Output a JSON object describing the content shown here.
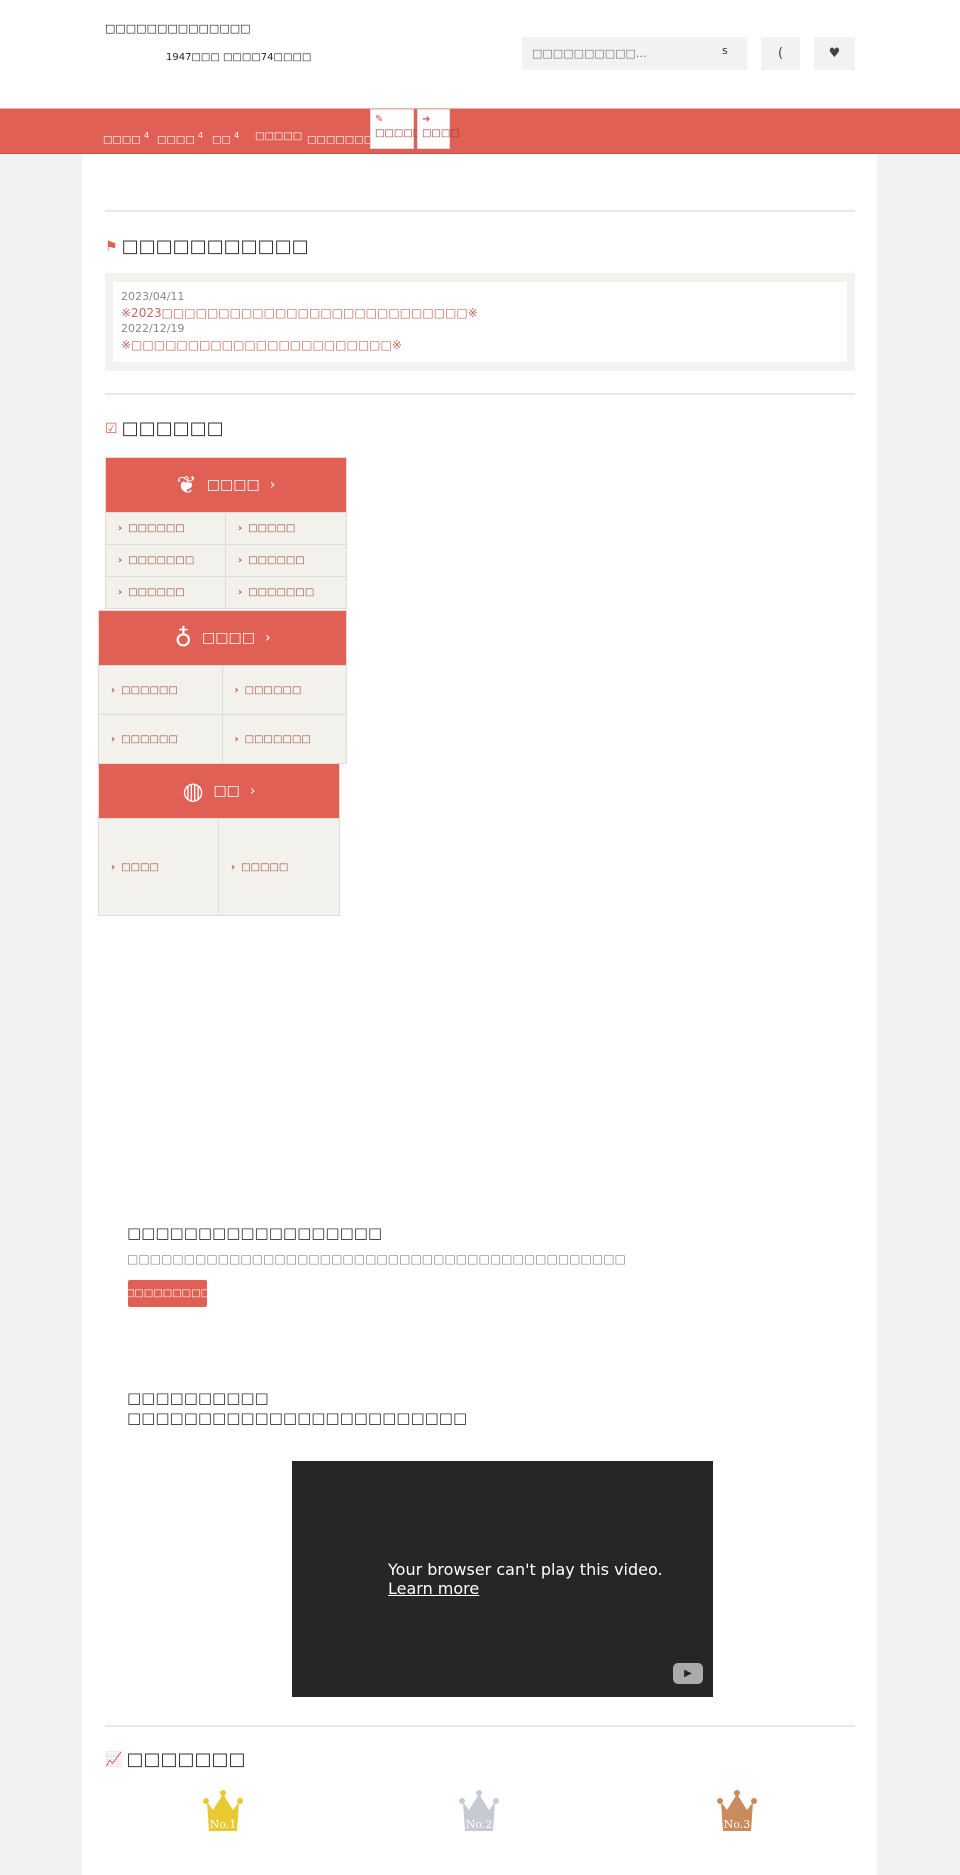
{
  "header": {
    "site_title": "□□□□□□□□□□□□□□",
    "site_subtitle": "1947□□□ □□□□74□□□□",
    "search_placeholder": "□□□□□□□□□□...",
    "search_button": "s",
    "button_1": "(",
    "favorite_icon": "heart-icon"
  },
  "nav": {
    "items": [
      {
        "label": "□□□□",
        "badge": "4"
      },
      {
        "label": "□□□□",
        "badge": "4"
      },
      {
        "label": "□□",
        "badge": "4"
      },
      {
        "label": "□□□□□",
        "badge": ""
      },
      {
        "label": "□□□□□□□",
        "badge": "4"
      }
    ],
    "register": "□□□□□□",
    "login": "□□□□"
  },
  "news": {
    "heading": "□□□□□□□□□□□",
    "items": [
      {
        "date": "2023/04/11",
        "title": "※2023□□□□□□□□□□□□□□□□□□□□□□□□□□□※"
      },
      {
        "date": "2022/12/19",
        "title": "※□□□□□□□□□□□□□□□□□□□□□□□※"
      }
    ]
  },
  "categories": {
    "heading": "□□□□□□",
    "groups": [
      {
        "title": "□□□□",
        "icon": "ginger-icon",
        "items": [
          "□□□□□□",
          "□□□□□",
          "□□□□□□□",
          "□□□□□□",
          "□□□□□□",
          "□□□□□□□"
        ]
      },
      {
        "title": "□□□□",
        "icon": "garlic-icon",
        "items": [
          "□□□□□□",
          "□□□□□□",
          "□□□□□□",
          "□□□□□□□"
        ]
      },
      {
        "title": "□□",
        "icon": "citrus-icon",
        "items": [
          "□□□□",
          "□□□□□"
        ]
      }
    ]
  },
  "promo": {
    "heading": "□□□□□□□□□□□□□□□□□□",
    "text": "□□□□□□□□□□□□□□□□□□□□□□□□□□□□□□□□□□□□□□□□□□□□",
    "button": "□□□□□□□□□"
  },
  "video_section": {
    "line1": "□□□□□□□□□□",
    "line2": "□□□□□□□□□□□□□□□□□□□□□□□□",
    "video_message": "Your browser can't play this video.",
    "video_link": "Learn more"
  },
  "ranking": {
    "heading": "□□□□□□□",
    "crowns": [
      {
        "label": "No.1",
        "color": "#e8c930"
      },
      {
        "label": "No.2",
        "color": "#c5cad3"
      },
      {
        "label": "No.3",
        "color": "#c98a5e"
      }
    ]
  },
  "colors": {
    "accent": "#e06055",
    "background": "#f2f2f2"
  }
}
